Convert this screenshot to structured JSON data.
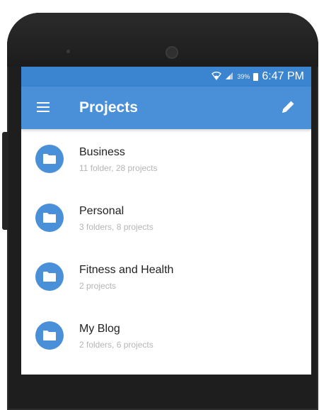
{
  "status_bar": {
    "battery_percent": "39%",
    "time": "6:47 PM",
    "wifi_icon": "wifi-icon",
    "signal_icon": "signal-icon",
    "battery_icon": "battery-icon"
  },
  "app_bar": {
    "title": "Projects",
    "menu_icon": "menu-icon",
    "edit_icon": "edit-icon"
  },
  "projects": [
    {
      "title": "Business",
      "subtitle": "11 folder, 28 projects"
    },
    {
      "title": "Personal",
      "subtitle": "3 folders, 8 projects"
    },
    {
      "title": "Fitness and Health",
      "subtitle": "2 projects"
    },
    {
      "title": "My Blog",
      "subtitle": "2 folders, 6 projects"
    }
  ],
  "colors": {
    "status_bar": "#3a84d0",
    "app_bar": "#4a90d9",
    "folder_avatar": "#4a90d9"
  }
}
